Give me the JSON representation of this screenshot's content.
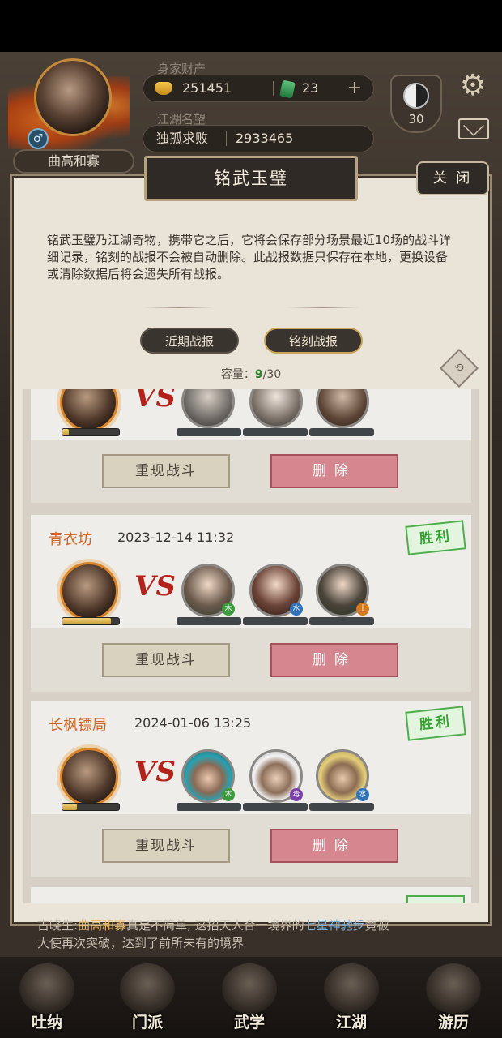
{
  "player": {
    "name": "曲高和寡",
    "wealth_label": "身家财产",
    "gold": "251451",
    "jade": "23",
    "fame_label": "江湖名望",
    "title": "独孤求败",
    "fame": "2933465",
    "level": "30"
  },
  "modal": {
    "title": "铭武玉璧",
    "close_label": "关 闭",
    "description": "铭武玉璧乃江湖奇物，携带它之后，它将会保存部分场景最近10场的战斗详细记录，铭刻的战报不会被自动删除。此战报数据只保存在本地，更换设备或清除数据后将会遗失所有战报。",
    "tabs": [
      "近期战报",
      "铭刻战报"
    ],
    "active_tab": "铭刻战报",
    "capacity_label": "容量：",
    "capacity_used": "9",
    "capacity_total": "/30"
  },
  "battles": [
    {
      "venue": "",
      "date": "",
      "result": "",
      "hero_hp": 0.12,
      "replay_label": "重现战斗",
      "delete_label": "删除"
    },
    {
      "venue": "青衣坊",
      "date": "2023-12-14 11:32",
      "result": "胜利",
      "hero_hp": 0.85,
      "replay_label": "重现战斗",
      "delete_label": "删除"
    },
    {
      "venue": "长枫镖局",
      "date": "2024-01-06 13:25",
      "result": "胜利",
      "hero_hp": 0.25,
      "replay_label": "重现战斗",
      "delete_label": "删除"
    }
  ],
  "vs_text": "VS",
  "chat": {
    "line1_prefix": "古晓生:",
    "line1_name": "曲高和寡",
    "line1_mid": "真是不简单, 这招天人合一境界的",
    "line1_skill": "七星神驰步",
    "line1_end": "竟被",
    "line2": "大使再次突破，达到了前所未有的境界"
  },
  "nav": [
    "吐纳",
    "门派",
    "武学",
    "江湖",
    "游历"
  ],
  "colors": {
    "win": "#37a033",
    "delete": "#d6868f",
    "venue": "#d36322"
  }
}
